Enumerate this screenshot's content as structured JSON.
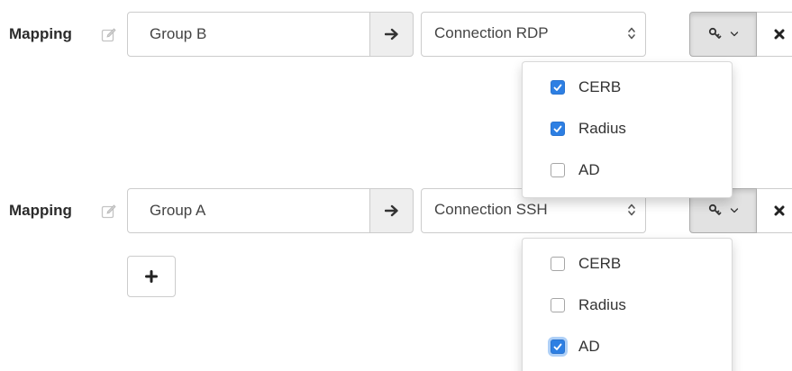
{
  "mappings": [
    {
      "label": "Mapping",
      "group_value": "Group B",
      "connection_value": "Connection RDP",
      "auth_options": [
        {
          "label": "CERB",
          "checked": true
        },
        {
          "label": "Radius",
          "checked": true
        },
        {
          "label": "AD",
          "checked": false
        }
      ]
    },
    {
      "label": "Mapping",
      "group_value": "Group A",
      "connection_value": "Connection SSH",
      "auth_options": [
        {
          "label": "CERB",
          "checked": false
        },
        {
          "label": "Radius",
          "checked": false
        },
        {
          "label": "AD",
          "checked": true
        }
      ]
    }
  ],
  "icons": {
    "edit": "edit-icon",
    "arrow": "arrow-right-icon",
    "select_caret": "sort-caret-icon",
    "auth": "key-icon",
    "auth_caret": "chevron-down-icon",
    "remove": "close-icon",
    "add": "plus-icon"
  },
  "colors": {
    "checkbox_checked": "#2d7fe3",
    "addon_background": "#eeeeee",
    "active_button_background": "#e2e2e2"
  }
}
